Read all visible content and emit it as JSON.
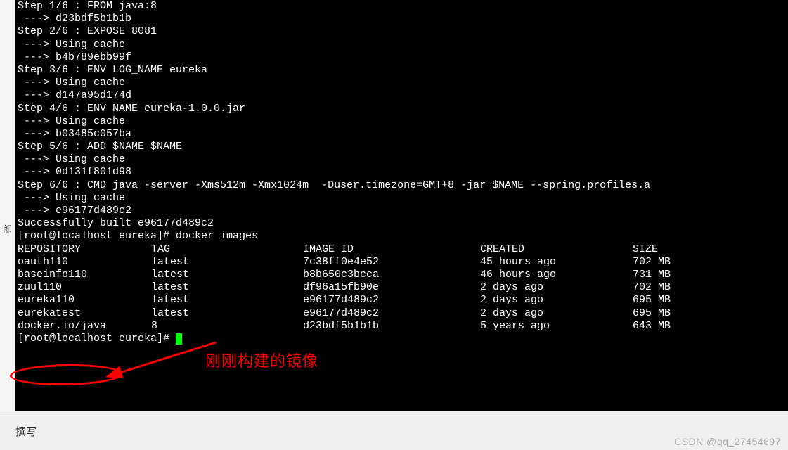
{
  "gutter": {
    "char1": "卽"
  },
  "build": {
    "steps": [
      {
        "header": "Step 1/6 : FROM java:8",
        "lines": [
          " ---> d23bdf5b1b1b"
        ]
      },
      {
        "header": "Step 2/6 : EXPOSE 8081",
        "lines": [
          " ---> Using cache",
          " ---> b4b789ebb99f"
        ]
      },
      {
        "header": "Step 3/6 : ENV LOG_NAME eureka",
        "lines": [
          " ---> Using cache",
          " ---> d147a95d174d"
        ]
      },
      {
        "header": "Step 4/6 : ENV NAME eureka-1.0.0.jar",
        "lines": [
          " ---> Using cache",
          " ---> b03485c057ba"
        ]
      },
      {
        "header": "Step 5/6 : ADD $NAME $NAME",
        "lines": [
          " ---> Using cache",
          " ---> 0d131f801d98"
        ]
      },
      {
        "header": "Step 6/6 : CMD java -server -Xms512m -Xmx1024m  -Duser.timezone=GMT+8 -jar $NAME --spring.profiles.a",
        "lines": [
          " ---> Using cache",
          " ---> e96177d489c2"
        ]
      }
    ],
    "success": "Successfully built e96177d489c2"
  },
  "prompt1": "[root@localhost eureka]# docker images",
  "images": {
    "headers": {
      "repository": "REPOSITORY",
      "tag": "TAG",
      "image_id": "IMAGE ID",
      "created": "CREATED",
      "size": "SIZE"
    },
    "rows": [
      {
        "repository": "oauth110",
        "tag": "latest",
        "image_id": "7c38ff0e4e52",
        "created": "45 hours ago",
        "size": "702 MB"
      },
      {
        "repository": "baseinfo110",
        "tag": "latest",
        "image_id": "b8b650c3bcca",
        "created": "46 hours ago",
        "size": "731 MB"
      },
      {
        "repository": "zuul110",
        "tag": "latest",
        "image_id": "df96a15fb90e",
        "created": "2 days ago",
        "size": "702 MB"
      },
      {
        "repository": "eureka110",
        "tag": "latest",
        "image_id": "e96177d489c2",
        "created": "2 days ago",
        "size": "695 MB"
      },
      {
        "repository": "eurekatest",
        "tag": "latest",
        "image_id": "e96177d489c2",
        "created": "2 days ago",
        "size": "695 MB"
      },
      {
        "repository": "docker.io/java",
        "tag": "8",
        "image_id": "d23bdf5b1b1b",
        "created": "5 years ago",
        "size": "643 MB"
      }
    ]
  },
  "prompt2": "[root@localhost eureka]# ",
  "annotation": {
    "text": "刚刚构建的镜像"
  },
  "bottom": {
    "compose": "撰写"
  },
  "watermark": "CSDN @qq_27454697"
}
